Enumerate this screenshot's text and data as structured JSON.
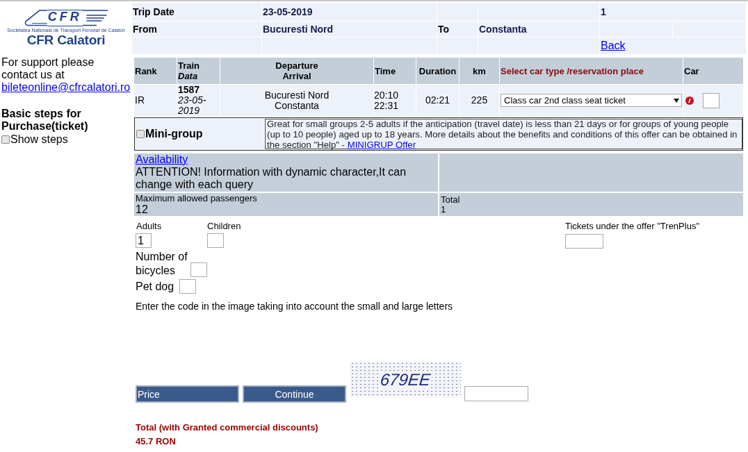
{
  "sidebar": {
    "logo": {
      "mark": "CFR",
      "tagline": "Societatea Nationala de Transport Feroviar de Calatori",
      "name": "CFR Calatori"
    },
    "support_text": "For support please contact us at",
    "support_email": "bileteonline@cfrcalatori.ro",
    "steps_title": "Basic steps for Purchase(ticket)",
    "show_steps": {
      "label": "Show steps",
      "checked": false
    }
  },
  "trip": {
    "date_label": "Trip Date",
    "date": "23-05-2019",
    "column_5": "1",
    "from_label": "From",
    "from": "Bucuresti Nord",
    "to_label": "To",
    "to": "Constanta",
    "back_link": "Back"
  },
  "trains": {
    "columns": [
      {
        "label": "Rank",
        "kind": "plain"
      },
      {
        "label": "Train",
        "sublabel": "Data",
        "kind": "stacked-italic"
      },
      {
        "label": "Departure",
        "sublabel": "Arrival",
        "kind": "stacked"
      },
      {
        "label": "Time",
        "kind": "plain"
      },
      {
        "label": "Duration",
        "kind": "plain"
      },
      {
        "label": "km",
        "kind": "plain"
      },
      {
        "label": "Select car type /reservation place",
        "kind": "accent"
      },
      {
        "label": "Car",
        "kind": "plain"
      }
    ],
    "rows": [
      {
        "rank": "IR",
        "train": "1587",
        "date": "23-05-2019",
        "departure": "Bucuresti Nord",
        "arrival": "Constanta",
        "departure_time": "20:10",
        "arrival_time": "22:31",
        "duration": "02:21",
        "km": "225",
        "car_type": "Class car 2nd class seat ticket"
      }
    ]
  },
  "mini_group": {
    "label": "Mini-group",
    "checked": false,
    "description": "Great for small groups 2-5 adults if the anticipation (travel date) is less than 21 days or for groups of young people (up to 10 people) aged up to 18 years. More details about the benefits and conditions of this offer can be obtained in the section \"Help\" -",
    "link": "MINIGRUP Offer"
  },
  "availability": {
    "link": "Availability",
    "notice": "ATTENTION! Information with dynamic character,It can change with each query",
    "max_label": "Maximum allowed passengers",
    "max_value": "12",
    "total_label": "Total",
    "total_value": "1"
  },
  "passengers": {
    "adults": {
      "label": "Adults",
      "value": "1"
    },
    "children": {
      "label": "Children"
    },
    "trenplus": {
      "label": "Tickets under the offer \"TrenPlus\""
    },
    "bicycles": {
      "label": "Number of bicycles"
    },
    "pet_dog": {
      "label": "Pet dog"
    }
  },
  "captcha": {
    "instruction": "Enter the code in the image taking into account the small and large letters",
    "code": "679EE"
  },
  "buttons": {
    "price": "Price",
    "continue": "Continue"
  },
  "total": {
    "label": "Total (with Granted commercial discounts)",
    "amount": "45.7 RON"
  }
}
